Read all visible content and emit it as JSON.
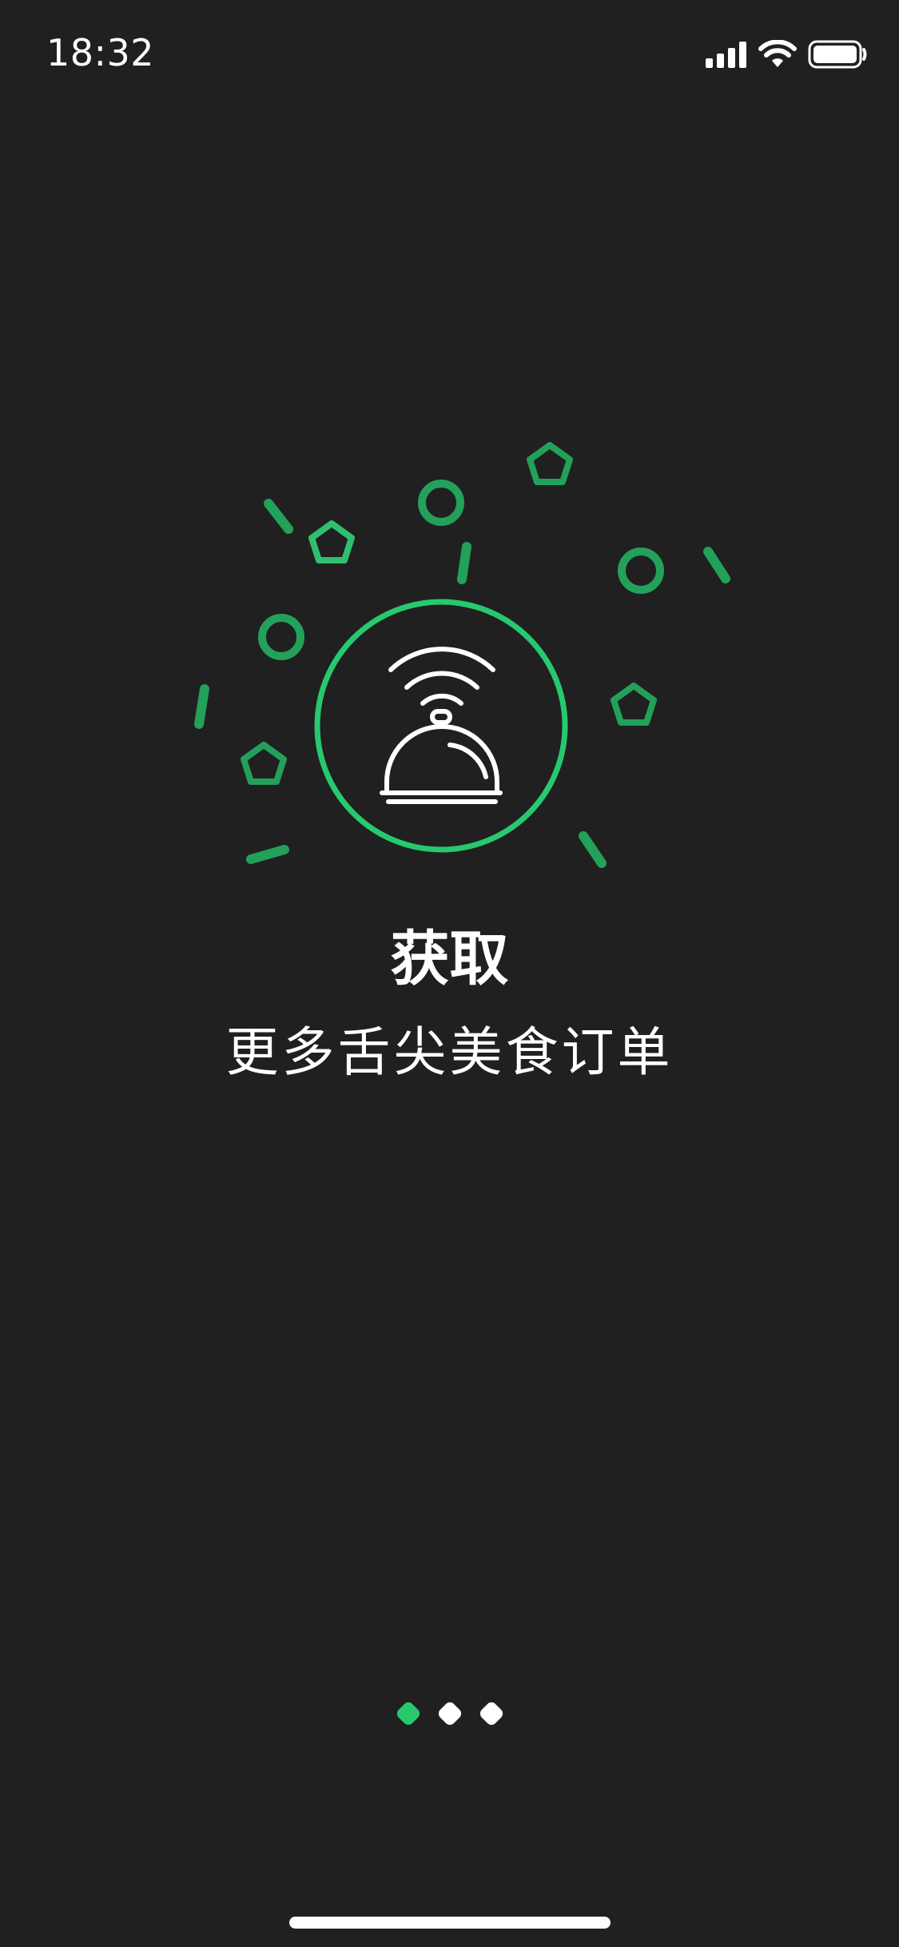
{
  "status_bar": {
    "time": "18:32",
    "icons": [
      "cellular-signal-icon",
      "wifi-icon",
      "battery-icon"
    ]
  },
  "onboarding": {
    "icon": "service-bell-wifi-icon",
    "title": "获取",
    "subtitle": "更多舌尖美食订单",
    "page_count": 3,
    "current_page": 1
  },
  "colors": {
    "background": "#202020",
    "accent": "#27c96e",
    "decoration": "#23a05a",
    "text": "#ffffff"
  }
}
